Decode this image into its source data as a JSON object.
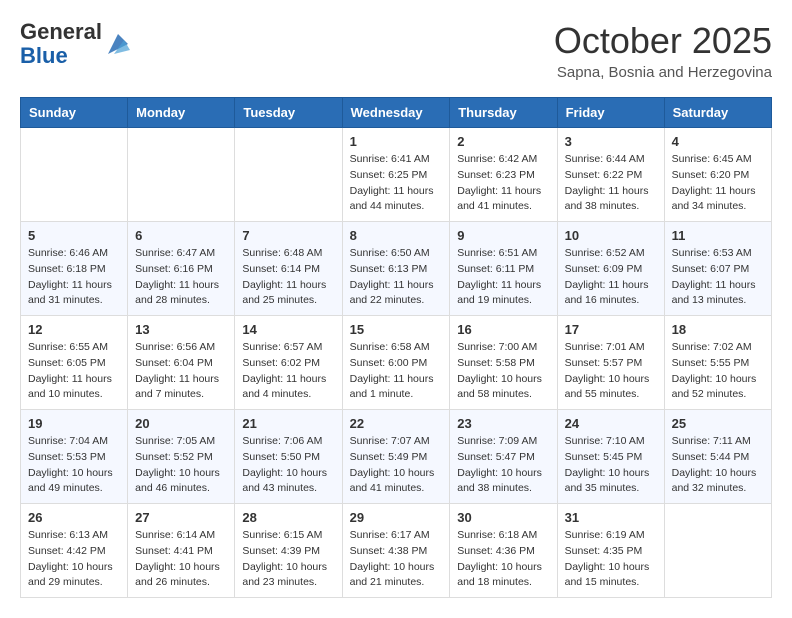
{
  "header": {
    "logo_general": "General",
    "logo_blue": "Blue",
    "month": "October 2025",
    "subtitle": "Sapna, Bosnia and Herzegovina"
  },
  "weekdays": [
    "Sunday",
    "Monday",
    "Tuesday",
    "Wednesday",
    "Thursday",
    "Friday",
    "Saturday"
  ],
  "weeks": [
    [
      {
        "day": "",
        "info": ""
      },
      {
        "day": "",
        "info": ""
      },
      {
        "day": "",
        "info": ""
      },
      {
        "day": "1",
        "info": "Sunrise: 6:41 AM\nSunset: 6:25 PM\nDaylight: 11 hours and 44 minutes."
      },
      {
        "day": "2",
        "info": "Sunrise: 6:42 AM\nSunset: 6:23 PM\nDaylight: 11 hours and 41 minutes."
      },
      {
        "day": "3",
        "info": "Sunrise: 6:44 AM\nSunset: 6:22 PM\nDaylight: 11 hours and 38 minutes."
      },
      {
        "day": "4",
        "info": "Sunrise: 6:45 AM\nSunset: 6:20 PM\nDaylight: 11 hours and 34 minutes."
      }
    ],
    [
      {
        "day": "5",
        "info": "Sunrise: 6:46 AM\nSunset: 6:18 PM\nDaylight: 11 hours and 31 minutes."
      },
      {
        "day": "6",
        "info": "Sunrise: 6:47 AM\nSunset: 6:16 PM\nDaylight: 11 hours and 28 minutes."
      },
      {
        "day": "7",
        "info": "Sunrise: 6:48 AM\nSunset: 6:14 PM\nDaylight: 11 hours and 25 minutes."
      },
      {
        "day": "8",
        "info": "Sunrise: 6:50 AM\nSunset: 6:13 PM\nDaylight: 11 hours and 22 minutes."
      },
      {
        "day": "9",
        "info": "Sunrise: 6:51 AM\nSunset: 6:11 PM\nDaylight: 11 hours and 19 minutes."
      },
      {
        "day": "10",
        "info": "Sunrise: 6:52 AM\nSunset: 6:09 PM\nDaylight: 11 hours and 16 minutes."
      },
      {
        "day": "11",
        "info": "Sunrise: 6:53 AM\nSunset: 6:07 PM\nDaylight: 11 hours and 13 minutes."
      }
    ],
    [
      {
        "day": "12",
        "info": "Sunrise: 6:55 AM\nSunset: 6:05 PM\nDaylight: 11 hours and 10 minutes."
      },
      {
        "day": "13",
        "info": "Sunrise: 6:56 AM\nSunset: 6:04 PM\nDaylight: 11 hours and 7 minutes."
      },
      {
        "day": "14",
        "info": "Sunrise: 6:57 AM\nSunset: 6:02 PM\nDaylight: 11 hours and 4 minutes."
      },
      {
        "day": "15",
        "info": "Sunrise: 6:58 AM\nSunset: 6:00 PM\nDaylight: 11 hours and 1 minute."
      },
      {
        "day": "16",
        "info": "Sunrise: 7:00 AM\nSunset: 5:58 PM\nDaylight: 10 hours and 58 minutes."
      },
      {
        "day": "17",
        "info": "Sunrise: 7:01 AM\nSunset: 5:57 PM\nDaylight: 10 hours and 55 minutes."
      },
      {
        "day": "18",
        "info": "Sunrise: 7:02 AM\nSunset: 5:55 PM\nDaylight: 10 hours and 52 minutes."
      }
    ],
    [
      {
        "day": "19",
        "info": "Sunrise: 7:04 AM\nSunset: 5:53 PM\nDaylight: 10 hours and 49 minutes."
      },
      {
        "day": "20",
        "info": "Sunrise: 7:05 AM\nSunset: 5:52 PM\nDaylight: 10 hours and 46 minutes."
      },
      {
        "day": "21",
        "info": "Sunrise: 7:06 AM\nSunset: 5:50 PM\nDaylight: 10 hours and 43 minutes."
      },
      {
        "day": "22",
        "info": "Sunrise: 7:07 AM\nSunset: 5:49 PM\nDaylight: 10 hours and 41 minutes."
      },
      {
        "day": "23",
        "info": "Sunrise: 7:09 AM\nSunset: 5:47 PM\nDaylight: 10 hours and 38 minutes."
      },
      {
        "day": "24",
        "info": "Sunrise: 7:10 AM\nSunset: 5:45 PM\nDaylight: 10 hours and 35 minutes."
      },
      {
        "day": "25",
        "info": "Sunrise: 7:11 AM\nSunset: 5:44 PM\nDaylight: 10 hours and 32 minutes."
      }
    ],
    [
      {
        "day": "26",
        "info": "Sunrise: 6:13 AM\nSunset: 4:42 PM\nDaylight: 10 hours and 29 minutes."
      },
      {
        "day": "27",
        "info": "Sunrise: 6:14 AM\nSunset: 4:41 PM\nDaylight: 10 hours and 26 minutes."
      },
      {
        "day": "28",
        "info": "Sunrise: 6:15 AM\nSunset: 4:39 PM\nDaylight: 10 hours and 23 minutes."
      },
      {
        "day": "29",
        "info": "Sunrise: 6:17 AM\nSunset: 4:38 PM\nDaylight: 10 hours and 21 minutes."
      },
      {
        "day": "30",
        "info": "Sunrise: 6:18 AM\nSunset: 4:36 PM\nDaylight: 10 hours and 18 minutes."
      },
      {
        "day": "31",
        "info": "Sunrise: 6:19 AM\nSunset: 4:35 PM\nDaylight: 10 hours and 15 minutes."
      },
      {
        "day": "",
        "info": ""
      }
    ]
  ]
}
